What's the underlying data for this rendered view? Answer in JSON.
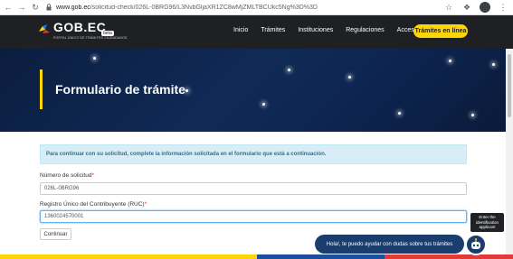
{
  "browser": {
    "url_host": "www.gob.ec",
    "url_path": "/solicitud-check/026L-0BRG96/L3NvbGljaXR1ZC8wMjZMLTBCUkc5Ng%3D%3D"
  },
  "header": {
    "logo_text": "GOB.EC",
    "logo_badge": "beta",
    "logo_subtitle": "PORTAL ÚNICO DE TRÁMITES CIUDADANOS",
    "menu": [
      "Inicio",
      "Trámites",
      "Instituciones",
      "Regulaciones",
      "Acceso"
    ],
    "cta_label": "Trámites en línea"
  },
  "hero": {
    "title": "Formulario de trámite"
  },
  "form": {
    "info_message": "Para continuar con su solicitud, complete la información solicitada en el formulario que está a continuación.",
    "fields": [
      {
        "label": "Número de solicitud",
        "required_mark": "*",
        "value": "026L-0BRG96"
      },
      {
        "label": "Registro Único del Contribuyente (RUC)",
        "required_mark": "*",
        "value": "1360024570001"
      }
    ],
    "submit_label": "Continuar"
  },
  "chat": {
    "message": "Hola!, te puedo ayudar con dudas sobre tus trámites",
    "tooltip": "Enter the identification applicant"
  },
  "colors": {
    "header_bg": "#1e2024",
    "accent_yellow": "#ffd600",
    "hero_bg": "#102a56",
    "info_bg": "#d9edf7",
    "chat_bg": "#1b3d6e"
  }
}
